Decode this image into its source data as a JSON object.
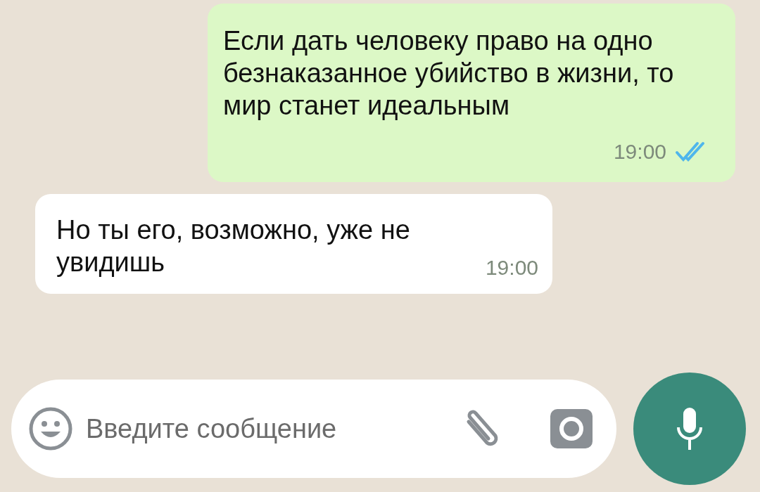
{
  "messages": [
    {
      "kind": "outgoing",
      "text": "Если дать человеку право на одно безнаказанное убийство в жизни, то мир станет идеальным",
      "time": "19:00",
      "read": true
    },
    {
      "kind": "incoming",
      "text": "Но ты его, возможно, уже не увидишь",
      "time": "19:00"
    }
  ],
  "composer": {
    "placeholder": "Введите сообщение"
  }
}
